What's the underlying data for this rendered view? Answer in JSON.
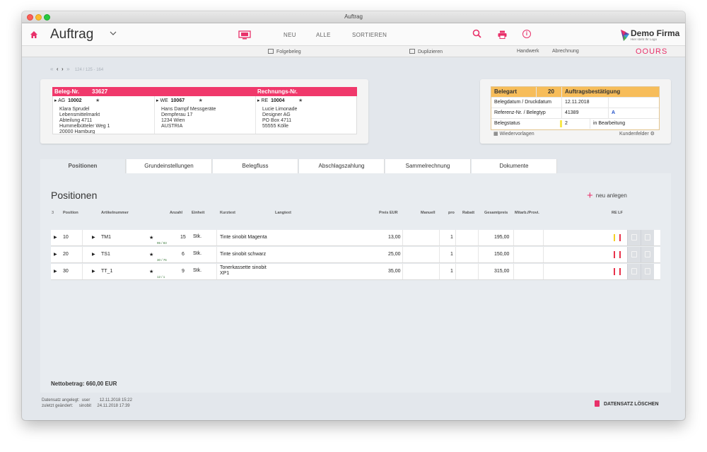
{
  "window": {
    "title": "Auftrag"
  },
  "nav": {
    "app_title": "Auftrag",
    "neu": "NEU",
    "alle": "ALLE",
    "sortieren": "SORTIEREN",
    "logo_name": "Demo Firma",
    "logo_sub": "Hier steht Ihr Logo"
  },
  "toolbar": {
    "folgebeleg": "Folgebeleg",
    "duplizieren": "Duplizieren",
    "handwerk": "Handwerk",
    "abrechnung": "Abrechnung",
    "brand": "OOURS"
  },
  "record_nav": {
    "count": "124 / 125 - 164"
  },
  "beleg": {
    "label": "Beleg-Nr.",
    "number": "33627",
    "rechnungs_label": "Rechnungs-Nr.",
    "ag": {
      "label": "AG",
      "number": "10002",
      "lines": "Klara Sprudel\nLebensmittelmarkt\nAbteilung 4711\nHummelbütteler Weg 1\n20000 Hamburg"
    },
    "we": {
      "label": "WE",
      "number": "10067",
      "lines": "Hans Dampf Messgeräte\nDempferau 17\n1234 Wien\nAUSTRIA"
    },
    "re": {
      "label": "RE",
      "number": "10004",
      "lines": "Lucie Limonade\nDesigner AG\nPO Box 4711\n55555 Kölle"
    }
  },
  "belegart": {
    "label": "Belegart",
    "code": "20",
    "type": "Auftragsbestätigung",
    "datum_label": "Belegdatum / Druckdatum",
    "datum": "12.11.2018",
    "ref_label": "Referenz-Nr. / Belegtyp",
    "ref": "41389",
    "belegtyp": "A",
    "status_label": "Belegstatus",
    "status_code": "2",
    "status_text": "in Bearbeitung",
    "wiedervorlagen": "Wiedervorlagen",
    "kundenfelder": "Kundenfelder"
  },
  "tabs": [
    "Positionen",
    "Grundeinstellungen",
    "Belegfluss",
    "Abschlagszahlung",
    "Sammelrechnung",
    "Dokumente"
  ],
  "positions": {
    "title": "Positionen",
    "new_label": "neu anlegen",
    "headers": {
      "count": "3",
      "position": "Position",
      "artikel": "Artikelnummer",
      "anzahl": "Anzahl",
      "einheit": "Einheit",
      "kurztext": "Kurztext",
      "langtext": "Langtext",
      "preis": "Preis EUR",
      "manuell": "Manuell",
      "pro": "pro",
      "rabatt": "Rabatt",
      "gesamt": "Gesamtpreis",
      "mitarb": "Mitarb./Provi.",
      "relf": "RE LF"
    },
    "rows": [
      {
        "pos": "10",
        "artikel": "TM1",
        "stock": "95 / 83",
        "anzahl": "15",
        "einheit": "Stk.",
        "kurztext": "Tinte sinobit Magenta",
        "preis": "13,00",
        "pro": "1",
        "gesamt": "195,00"
      },
      {
        "pos": "20",
        "artikel": "TS1",
        "stock": "30 / 76",
        "anzahl": "6",
        "einheit": "Stk.",
        "kurztext": "Tinte sinobit schwarz",
        "preis": "25,00",
        "pro": "1",
        "gesamt": "150,00"
      },
      {
        "pos": "30",
        "artikel": "TT_1",
        "stock": "12 / 1",
        "anzahl": "9",
        "einheit": "Stk.",
        "kurztext": "Tonerkassette sinobit XP1",
        "preis": "35,00",
        "pro": "1",
        "gesamt": "315,00"
      }
    ],
    "netto": "Nettobetrag:  660,00  EUR"
  },
  "footer": {
    "meta": "Datensatz angelegt:  user        12.11.2018 15:22\nzuletzt geändert:     sinobit     24.11.2018 17:39",
    "delete": "DATENSATZ LÖSCHEN"
  },
  "colors": {
    "accent": "#e8316a",
    "beleg_bar": "#f0386b",
    "belegart_bar": "#f7bd5a"
  }
}
